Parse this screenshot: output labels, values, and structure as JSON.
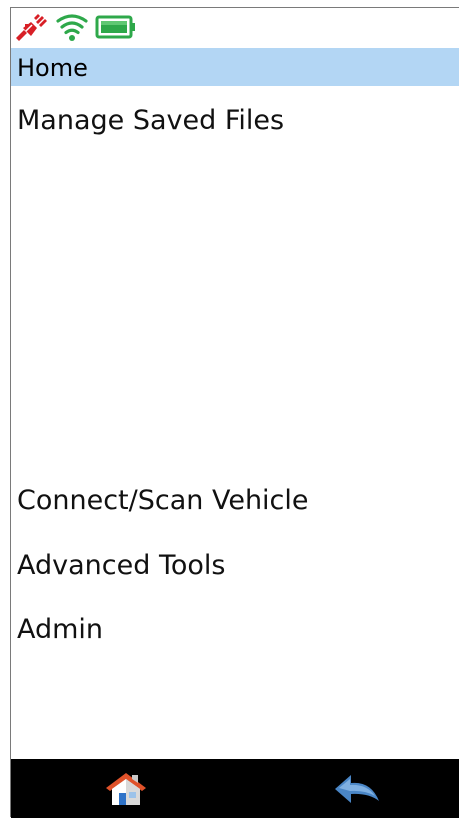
{
  "status_icons": [
    "disconnected-plug-icon",
    "wifi-icon",
    "battery-icon"
  ],
  "header": {
    "title": "Home"
  },
  "menu": {
    "items": [
      {
        "label": "Manage Saved Files"
      },
      {
        "label": "Connect/Scan Vehicle"
      },
      {
        "label": "Advanced Tools"
      },
      {
        "label": "Admin"
      }
    ]
  },
  "footer": {
    "buttons": [
      "home-icon",
      "back-icon"
    ]
  },
  "colors": {
    "title_bar": "#b3d6f4",
    "footer_bar": "#000000",
    "wifi_battery": "#2ea84a",
    "plug": "#d81f26",
    "back_arrow": "#4a86c6"
  }
}
